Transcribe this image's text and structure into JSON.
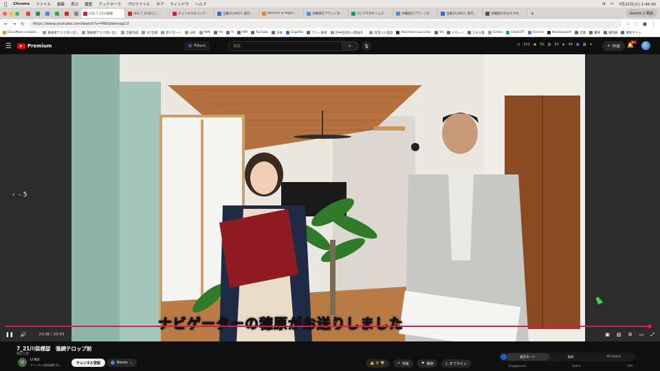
{
  "menubar": {
    "app_name": "Chrome",
    "items": [
      "ファイル",
      "編集",
      "表示",
      "履歴",
      "ブックマーク",
      "プロファイル",
      "タブ",
      "ウィンドウ",
      "ヘルプ"
    ],
    "clock": "7月22日(火) 1:46:30"
  },
  "tabs": [
    {
      "label": "(33) 7_21川俣様",
      "active": true,
      "color": "#e31b23"
    },
    {
      "label": "(93) 7_21あびこ...",
      "active": false,
      "color": "#e31b23"
    },
    {
      "label": "チャンネルのコンテ...",
      "active": false,
      "color": "#e31b23"
    },
    {
      "label": "当番10,000人 進行...",
      "active": false,
      "color": "#1a73e8"
    },
    {
      "label": "Workers & Pages...",
      "active": false,
      "color": "#f38020"
    },
    {
      "label": "沖縄旅行プラン | 計...",
      "active": false,
      "color": "#4a90e2"
    },
    {
      "label": "(2) ママボホームズ...",
      "active": false,
      "color": "#0f9d58"
    },
    {
      "label": "沖縄旅行プラン | 計...",
      "active": false,
      "color": "#4a90e2"
    },
    {
      "label": "当番10,000人 進行...",
      "active": false,
      "color": "#1a73e8"
    },
    {
      "label": "沖縄旅行のおすすめ...",
      "active": false,
      "color": "#555555"
    }
  ],
  "gemini_button": "Gemini に相談",
  "address": {
    "url": "https://www.youtube.com/watch?v=M93dwtnagCU"
  },
  "bookmarks": [
    {
      "label": "Cloudflare analytic...",
      "folder": false,
      "color": "#f38020"
    },
    {
      "label": "最後者テスク見い出し",
      "folder": false,
      "color": "#999999"
    },
    {
      "label": "最後者テスク見い出し",
      "folder": false,
      "color": "#999999"
    },
    {
      "label": "自動作成",
      "folder": false,
      "color": "#999999"
    },
    {
      "label": "SIT出版",
      "folder": false,
      "color": "#999999"
    },
    {
      "label": "新パターン",
      "folder": false,
      "color": "#999999"
    },
    {
      "label": "分析",
      "folder": false,
      "color": "#999999"
    },
    {
      "label": "WIN",
      "folder": false,
      "color": "#999999"
    },
    {
      "label": "YH",
      "folder": true,
      "color": "#6a6a6a"
    },
    {
      "label": "YI",
      "folder": false,
      "color": "#3b73d9"
    },
    {
      "label": "MM",
      "folder": false,
      "color": "#7b4bc9"
    },
    {
      "label": "YouTube",
      "folder": true,
      "color": "#6a6a6a"
    },
    {
      "label": "日本",
      "folder": true,
      "color": "#6a6a6a"
    },
    {
      "label": "GigaFile",
      "folder": false,
      "color": "#1a73e8"
    },
    {
      "label": "フリー素材",
      "folder": true,
      "color": "#6a6a6a"
    },
    {
      "label": "日中合同の入稿強子...",
      "folder": false,
      "color": "#999999"
    },
    {
      "label": "日常バル連出",
      "folder": false,
      "color": "#999999"
    },
    {
      "label": "Alnchmm Launcher",
      "folder": false,
      "color": "#333333"
    },
    {
      "label": "YH",
      "folder": true,
      "color": "#6a6a6a"
    },
    {
      "label": "ドローン",
      "folder": true,
      "color": "#6a6a6a"
    },
    {
      "label": "スキル集",
      "folder": true,
      "color": "#6a6a6a"
    },
    {
      "label": "Gmms",
      "folder": false,
      "color": "#999999"
    },
    {
      "label": "ChatGPT",
      "folder": false,
      "color": "#10a37f"
    },
    {
      "label": "Gemini",
      "folder": false,
      "color": "#4a7fe8"
    },
    {
      "label": "NotebookLM",
      "folder": false,
      "color": "#333333"
    },
    {
      "label": "営業",
      "folder": true,
      "color": "#6a6a6a"
    },
    {
      "label": "趣味",
      "folder": true,
      "color": "#6a6a6a"
    },
    {
      "label": "複和器",
      "folder": true,
      "color": "#6a6a6a"
    },
    {
      "label": "便利サイト",
      "folder": true,
      "color": "#6a6a6a"
    }
  ],
  "youtube": {
    "logo_text": "Premium",
    "filters_label": "Filters",
    "search_placeholder": "検索",
    "stats": [
      "311",
      "50",
      "50",
      "48"
    ],
    "create_label": "作成",
    "notif_count": "9+"
  },
  "player": {
    "prev_label": "- 5",
    "subtitle": "ナビゲーターの穂原がお送りしました",
    "time": "23:36 / 23:43",
    "progress_fraction": 0.995
  },
  "video": {
    "title": "7_21川俣様邸　強調テロップ前",
    "visibility": "限定公開",
    "channel_initial": "U",
    "channel_name": "U KO",
    "subscriber_count": "チャンネル登録者数 8人",
    "subscribe_label": "チャンネル登録",
    "remix_label": "Remix",
    "like_count": "0",
    "share_label": "共有",
    "save_label": "保存",
    "offline_label": "オフライン"
  },
  "panel": {
    "tabs": [
      "表示モード",
      "概要",
      "AI Coach"
    ],
    "labels": [
      "Engagement",
      "Outlier",
      "VPH"
    ]
  }
}
